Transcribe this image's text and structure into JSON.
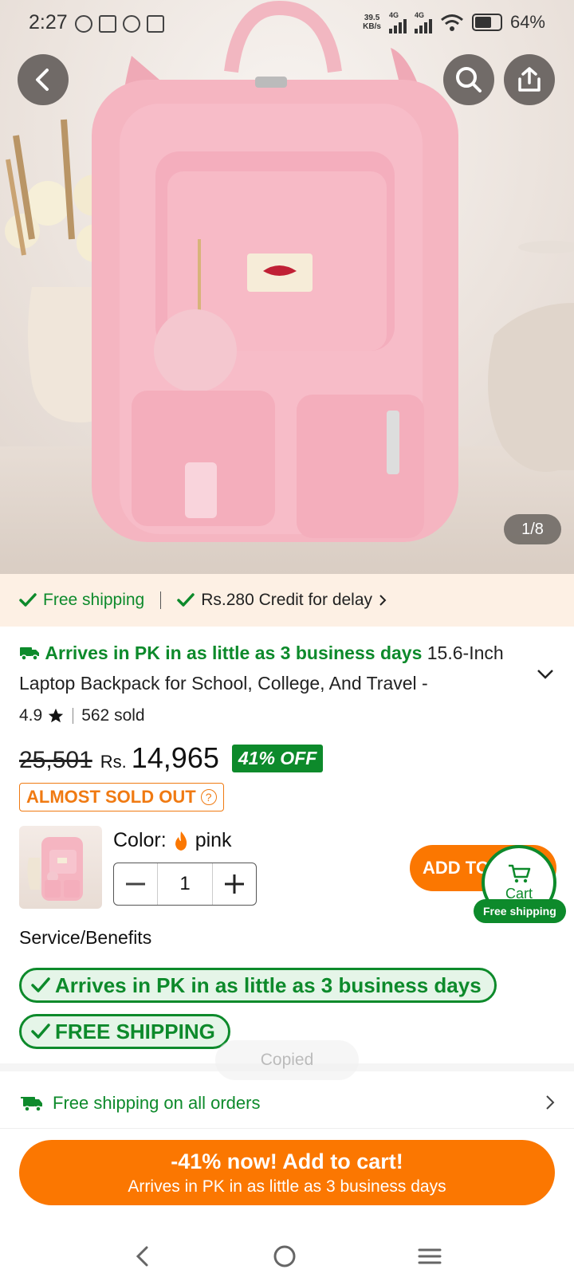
{
  "status_bar": {
    "time": "2:27",
    "speed_value": "39.5",
    "speed_unit": "KB/s",
    "net1": "4G",
    "net2": "4G",
    "battery": "64%"
  },
  "gallery": {
    "page_indicator": "1/8"
  },
  "shipping_band": {
    "free_shipping": "Free shipping",
    "credit": "Rs.280 Credit for delay"
  },
  "product": {
    "arrives": "Arrives in PK in as little as 3 business days",
    "title": " 15.6-Inch Laptop Backpack for School, College, And Travel -",
    "rating": "4.9",
    "sold": "562 sold",
    "old_price": "25,501",
    "currency": "Rs.",
    "price": "14,965",
    "discount": "41% OFF",
    "almost_sold_out": "ALMOST SOLD OUT"
  },
  "selection": {
    "color_label": "Color:",
    "color_value": "pink",
    "quantity": "1",
    "add_to_cart": "ADD TO CART",
    "cart_label": "Cart",
    "cart_free_shipping": "Free shipping"
  },
  "services": {
    "title": "Service/Benefits",
    "pill1": "Arrives in PK in as little as 3 business days",
    "pill2": "FREE SHIPPING"
  },
  "toast": "Copied",
  "free_all": "Free shipping on all orders",
  "cta": {
    "line1": "-41% now! Add to cart!",
    "line2": "Arrives in PK in as little as 3 business days"
  },
  "colors": {
    "accent_orange": "#fb7701",
    "accent_green": "#0d8a2b",
    "band_bg": "#fdf0e4"
  }
}
